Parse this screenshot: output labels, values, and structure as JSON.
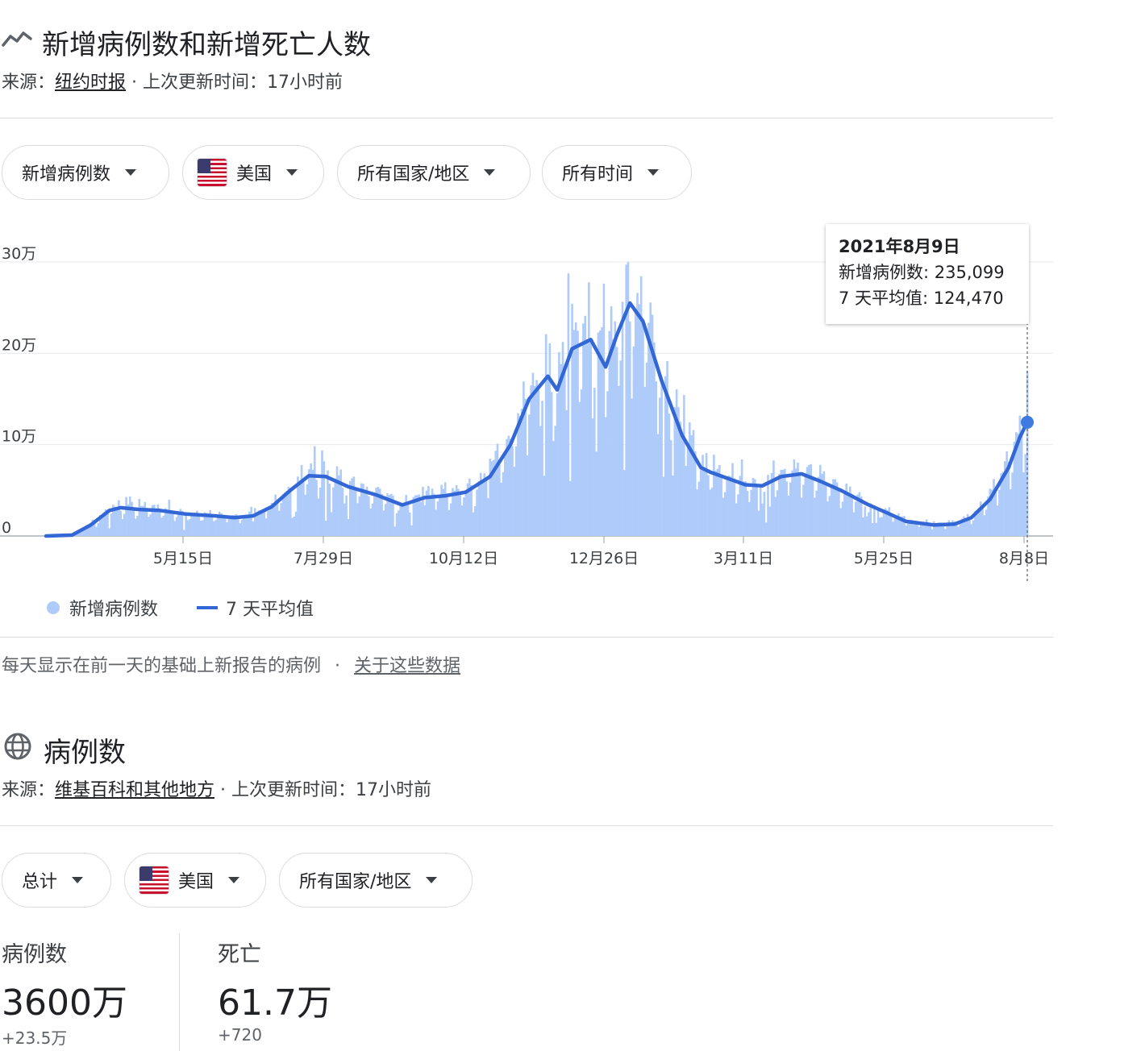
{
  "section1": {
    "title": "新增病例数和新增死亡人数",
    "source_prefix": "来源：",
    "source_link": "纽约时报",
    "updated": " · 上次更新时间：17小时前",
    "filters": [
      {
        "label": "新增病例数"
      },
      {
        "label": "美国",
        "flag": true
      },
      {
        "label": "所有国家/地区"
      },
      {
        "label": "所有时间"
      }
    ],
    "tooltip": {
      "date": "2021年8月9日",
      "cases": "新增病例数: 235,099",
      "avg": "7 天平均值: 124,470"
    },
    "legend": {
      "bars": "新增病例数",
      "line": "7 天平均值"
    },
    "footnote": "每天显示在前一天的基础上新报告的病例",
    "footnote_sep": "·",
    "footnote_link": "关于这些数据"
  },
  "section2": {
    "title": "病例数",
    "source_prefix": "来源：",
    "source_link": "维基百科和其他地方",
    "updated": " · 上次更新时间：17小时前",
    "filters": [
      {
        "label": "总计"
      },
      {
        "label": "美国",
        "flag": true
      },
      {
        "label": "所有国家/地区"
      }
    ],
    "stats": [
      {
        "label": "病例数",
        "value": "3600万",
        "delta": "+23.5万"
      },
      {
        "label": "死亡",
        "value": "61.7万",
        "delta": "+720"
      }
    ]
  },
  "colors": {
    "bars": "#aecbfa",
    "line": "#3367d6",
    "grid": "#e8eaed"
  },
  "chart_data": {
    "type": "bar",
    "x_axis": "date",
    "x_ticks": [
      "5月15日",
      "7月29日",
      "10月12日",
      "12月26日",
      "3月11日",
      "5月25日",
      "8月8日"
    ],
    "x_range": [
      "2020-03-01",
      "2021-08-09"
    ],
    "y_ticks": [
      "0",
      "10万",
      "20万",
      "30万"
    ],
    "ylim": [
      0,
      300000
    ],
    "series": [
      {
        "name": "新增病例数",
        "type": "bar"
      },
      {
        "name": "7 天平均值",
        "type": "line",
        "points": [
          [
            "2020-03-01",
            0
          ],
          [
            "2020-03-15",
            1000
          ],
          [
            "2020-03-25",
            12000
          ],
          [
            "2020-04-04",
            28000
          ],
          [
            "2020-04-10",
            31000
          ],
          [
            "2020-04-20",
            29000
          ],
          [
            "2020-05-01",
            28000
          ],
          [
            "2020-05-15",
            24000
          ],
          [
            "2020-05-31",
            22000
          ],
          [
            "2020-06-10",
            20000
          ],
          [
            "2020-06-20",
            22000
          ],
          [
            "2020-06-30",
            32000
          ],
          [
            "2020-07-10",
            50000
          ],
          [
            "2020-07-20",
            66000
          ],
          [
            "2020-07-29",
            65000
          ],
          [
            "2020-08-10",
            54000
          ],
          [
            "2020-08-25",
            45000
          ],
          [
            "2020-09-08",
            34000
          ],
          [
            "2020-09-20",
            42000
          ],
          [
            "2020-10-01",
            44000
          ],
          [
            "2020-10-12",
            48000
          ],
          [
            "2020-10-25",
            65000
          ],
          [
            "2020-11-05",
            100000
          ],
          [
            "2020-11-15",
            150000
          ],
          [
            "2020-11-25",
            175000
          ],
          [
            "2020-11-30",
            160000
          ],
          [
            "2020-12-08",
            205000
          ],
          [
            "2020-12-18",
            215000
          ],
          [
            "2020-12-26",
            185000
          ],
          [
            "2021-01-01",
            220000
          ],
          [
            "2021-01-08",
            255000
          ],
          [
            "2021-01-15",
            235000
          ],
          [
            "2021-01-25",
            170000
          ],
          [
            "2021-02-05",
            110000
          ],
          [
            "2021-02-15",
            75000
          ],
          [
            "2021-02-20",
            70000
          ],
          [
            "2021-03-11",
            56000
          ],
          [
            "2021-03-20",
            55000
          ],
          [
            "2021-03-30",
            65000
          ],
          [
            "2021-04-10",
            68000
          ],
          [
            "2021-04-20",
            60000
          ],
          [
            "2021-05-01",
            50000
          ],
          [
            "2021-05-15",
            35000
          ],
          [
            "2021-05-25",
            26000
          ],
          [
            "2021-06-05",
            16000
          ],
          [
            "2021-06-20",
            12000
          ],
          [
            "2021-07-01",
            13000
          ],
          [
            "2021-07-10",
            20000
          ],
          [
            "2021-07-20",
            40000
          ],
          [
            "2021-07-30",
            75000
          ],
          [
            "2021-08-05",
            108000
          ],
          [
            "2021-08-09",
            124470
          ]
        ]
      }
    ],
    "tooltip_point": [
      "2021-08-09",
      124470
    ],
    "legend_position": "bottom-left",
    "grid": true
  }
}
